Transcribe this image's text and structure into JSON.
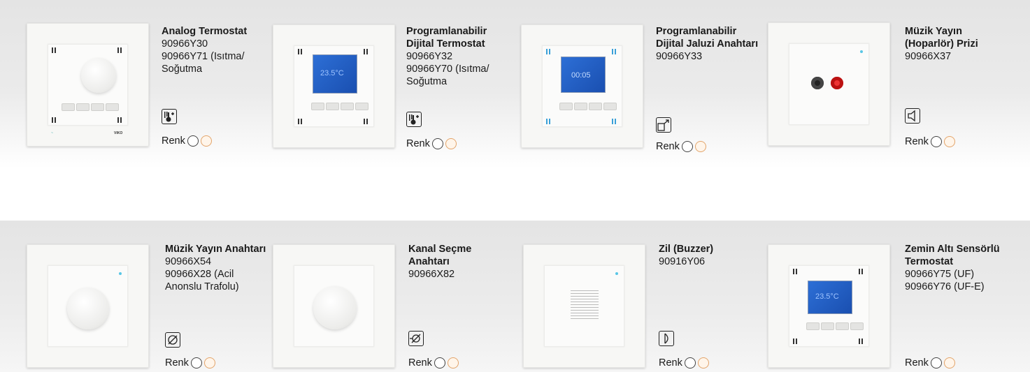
{
  "renk_label": "Renk",
  "products": [
    {
      "name": "Analog Termostat",
      "codes": [
        "90966Y30",
        "90966Y71 (Isıtma/ Soğutma"
      ],
      "icon": "thermostat-icon"
    },
    {
      "name": "Programlanabilir Dijital Termostat",
      "codes": [
        "90966Y32",
        "90966Y70 (Isıtma/ Soğutma"
      ],
      "icon": "thermostat-icon",
      "display": "23.5°C"
    },
    {
      "name": "Programlanabilir Dijital Jaluzi Anahtarı",
      "codes": [
        "90966Y33"
      ],
      "icon": "blind-icon",
      "display": "00:05"
    },
    {
      "name": "Müzik Yayın (Hoparlör) Prizi",
      "codes": [
        "90966X37"
      ],
      "icon": "speaker-icon"
    },
    {
      "name": "Müzik Yayın Anahtarı",
      "codes": [
        "90966X54",
        "90966X28 (Acil Anonslu Trafolu)"
      ],
      "icon": "dimmer-icon"
    },
    {
      "name": "Kanal Seçme Anahtarı",
      "codes": [
        "90966X82"
      ],
      "icon": "channel-switch-icon"
    },
    {
      "name": "Zil (Buzzer)",
      "codes": [
        "90916Y06"
      ],
      "icon": "buzzer-icon"
    },
    {
      "name": "Zemin Altı Sensörlü Termostat",
      "codes": [
        "90966Y75 (UF)",
        "90966Y76 (UF-E)"
      ],
      "icon": "thermostat-icon",
      "display": "23.5°C"
    }
  ],
  "colors": {
    "white": "#ffffff",
    "beige": "#f3c9a0"
  }
}
